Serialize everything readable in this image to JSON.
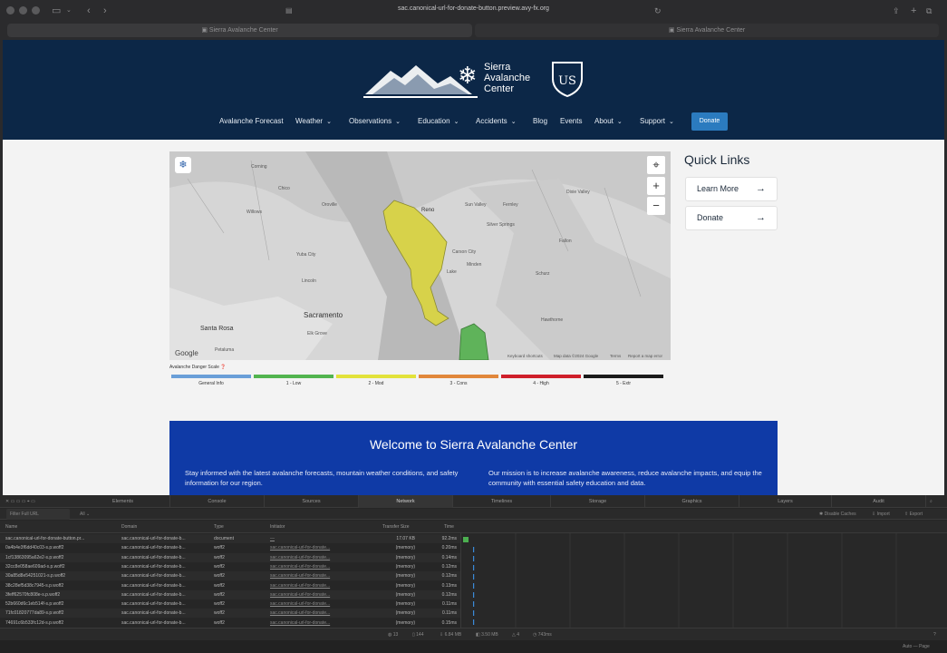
{
  "browser": {
    "url": "sac.canonical-url-for-donate-button.preview.avy-fx.org",
    "tabs": [
      "Sierra Avalanche Center",
      "Sierra Avalanche Center"
    ]
  },
  "site": {
    "logo_lines": [
      "Sierra",
      "Avalanche",
      "Center"
    ],
    "nav": [
      "Avalanche Forecast",
      "Weather",
      "Observations",
      "Education",
      "Accidents",
      "Blog",
      "Events",
      "About",
      "Support"
    ],
    "donate": "Donate",
    "quick_links": {
      "title": "Quick Links",
      "learn_more": "Learn More",
      "donate": "Donate"
    },
    "map": {
      "labels": [
        "Corning",
        "Chico",
        "Willows",
        "Oroville",
        "Yuba City",
        "Lincoln",
        "Sacramento",
        "Elk Grove",
        "Santa Rosa",
        "Petaluma",
        "Reno",
        "Sun Valley",
        "Fernley",
        "Silver Springs",
        "Carson City",
        "Minden",
        "Lake",
        "Schurz",
        "Hawthorne",
        "Dixie Valley",
        "Fallon"
      ],
      "attribution": [
        "Keyboard shortcuts",
        "Map data ©2024 Google",
        "Terms",
        "Report a map error"
      ],
      "google": "Google"
    },
    "danger_scale": {
      "title": "Avalanche Danger Scale",
      "levels": [
        {
          "label": "General Info",
          "color": "#6a9fd8"
        },
        {
          "label": "1 - Low",
          "color": "#52b44f"
        },
        {
          "label": "2 - Mod",
          "color": "#e2e23a"
        },
        {
          "label": "3 - Cons",
          "color": "#e1873b"
        },
        {
          "label": "4 - High",
          "color": "#cf1f2a"
        },
        {
          "label": "5 - Extr",
          "color": "#1a1a1a"
        }
      ]
    },
    "welcome": {
      "title": "Welcome to Sierra Avalanche Center",
      "left": "Stay informed with the latest avalanche forecasts, mountain weather conditions, and safety information for our region.",
      "right": "Our mission is to increase avalanche awareness, reduce avalanche impacts, and equip the community with essential safety education and data."
    }
  },
  "devtools": {
    "tabs": [
      "Elements",
      "Console",
      "Sources",
      "Network",
      "Timelines",
      "Storage",
      "Graphics",
      "Layers",
      "Audit"
    ],
    "filter_placeholder": "Filter Full URL",
    "filter_type": "All",
    "right_actions": [
      "Disable Caches",
      "Import",
      "Export"
    ],
    "columns": [
      "Name",
      "Domain",
      "Type",
      "Initiator",
      "Transfer Size",
      "Time"
    ],
    "rows": [
      {
        "name": "sac.canonical-url-for-donate-button.pr...",
        "domain": "sac.canonical-url-for-donate-b...",
        "type": "document",
        "initiator": "—",
        "size": "17.07 KB",
        "time": "92.2ms"
      },
      {
        "name": "0a4b4e3f6dd40c03-s.p.woff2",
        "domain": "sac.canonical-url-for-donate-b...",
        "type": "woff2",
        "initiator": "sac.canonical-url-for-donate...",
        "size": "(memory)",
        "time": "0.20ms"
      },
      {
        "name": "1cf13863095a62e2-s.p.woff2",
        "domain": "sac.canonical-url-for-donate-b...",
        "type": "woff2",
        "initiator": "sac.canonical-url-for-donate...",
        "size": "(memory)",
        "time": "0.14ms"
      },
      {
        "name": "32cc8e058ae609ad-s.p.woff2",
        "domain": "sac.canonical-url-for-donate-b...",
        "type": "woff2",
        "initiator": "sac.canonical-url-for-donate...",
        "size": "(memory)",
        "time": "0.12ms"
      },
      {
        "name": "30a85d8e54251021-s.p.woff2",
        "domain": "sac.canonical-url-for-donate-b...",
        "type": "woff2",
        "initiator": "sac.canonical-url-for-donate...",
        "size": "(memory)",
        "time": "0.12ms"
      },
      {
        "name": "38c28ef5d38c7945-s.p.woff2",
        "domain": "sac.canonical-url-for-donate-b...",
        "type": "woff2",
        "initiator": "sac.canonical-url-for-donate...",
        "size": "(memory)",
        "time": "0.13ms"
      },
      {
        "name": "3feff62570fc808e-s.p.woff2",
        "domain": "sac.canonical-url-for-donate-b...",
        "type": "woff2",
        "initiator": "sac.canonical-url-for-donate...",
        "size": "(memory)",
        "time": "0.12ms"
      },
      {
        "name": "52b660d6c1eb514f-s.p.woff2",
        "domain": "sac.canonical-url-for-donate-b...",
        "type": "woff2",
        "initiator": "sac.canonical-url-for-donate...",
        "size": "(memory)",
        "time": "0.11ms"
      },
      {
        "name": "71fc01820777da89-s.p.woff2",
        "domain": "sac.canonical-url-for-donate-b...",
        "type": "woff2",
        "initiator": "sac.canonical-url-for-donate...",
        "size": "(memory)",
        "time": "0.11ms"
      },
      {
        "name": "74691c6b533fc12d-s.p.woff2",
        "domain": "sac.canonical-url-for-donate-b...",
        "type": "woff2",
        "initiator": "sac.canonical-url-for-donate...",
        "size": "(memory)",
        "time": "0.15ms"
      }
    ],
    "status": {
      "requests": "13",
      "resources": "144",
      "transferred": "6.84 MB",
      "size": "3.50 MB",
      "count": "4",
      "time": "743ms"
    },
    "page_selector": "Auto — Page"
  }
}
